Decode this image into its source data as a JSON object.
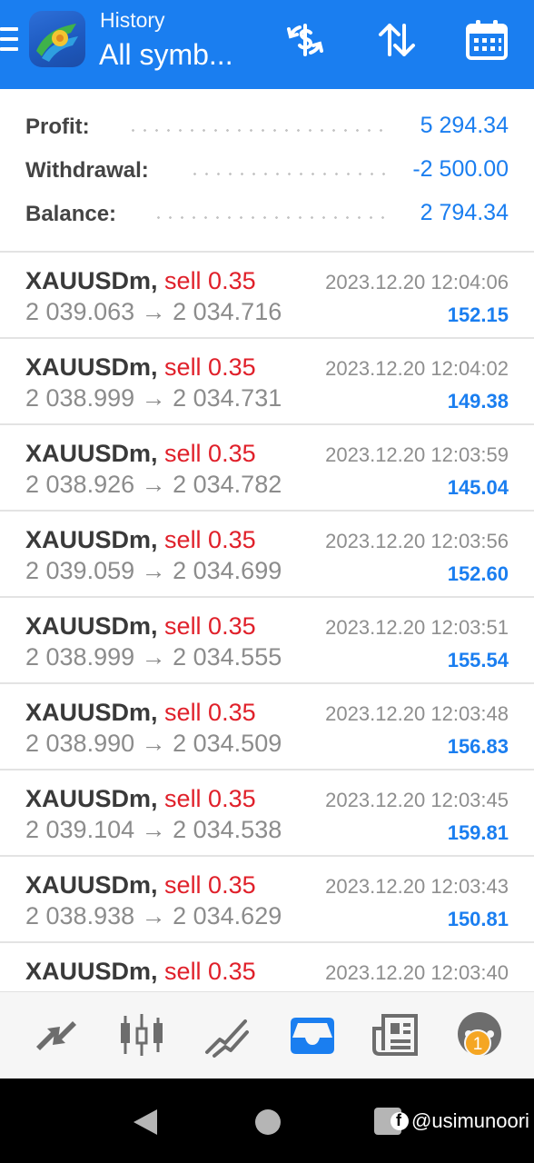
{
  "header": {
    "subtitle": "History",
    "title": "All symb...",
    "buttons": [
      "currency-exchange-icon",
      "sort-icon",
      "calendar-icon"
    ]
  },
  "summary": {
    "profit_label": "Profit:",
    "profit_value": "5 294.34",
    "withdrawal_label": "Withdrawal:",
    "withdrawal_value": "-2 500.00",
    "balance_label": "Balance:",
    "balance_value": "2 794.34"
  },
  "trades": [
    {
      "symbol": "XAUUSDm,",
      "side": "sell 0.35",
      "prices": "2 039.063 → 2 034.716",
      "time": "2023.12.20 12:04:06",
      "profit": "152.15"
    },
    {
      "symbol": "XAUUSDm,",
      "side": "sell 0.35",
      "prices": "2 038.999 → 2 034.731",
      "time": "2023.12.20 12:04:02",
      "profit": "149.38"
    },
    {
      "symbol": "XAUUSDm,",
      "side": "sell 0.35",
      "prices": "2 038.926 → 2 034.782",
      "time": "2023.12.20 12:03:59",
      "profit": "145.04"
    },
    {
      "symbol": "XAUUSDm,",
      "side": "sell 0.35",
      "prices": "2 039.059 → 2 034.699",
      "time": "2023.12.20 12:03:56",
      "profit": "152.60"
    },
    {
      "symbol": "XAUUSDm,",
      "side": "sell 0.35",
      "prices": "2 038.999 → 2 034.555",
      "time": "2023.12.20 12:03:51",
      "profit": "155.54"
    },
    {
      "symbol": "XAUUSDm,",
      "side": "sell 0.35",
      "prices": "2 038.990 → 2 034.509",
      "time": "2023.12.20 12:03:48",
      "profit": "156.83"
    },
    {
      "symbol": "XAUUSDm,",
      "side": "sell 0.35",
      "prices": "2 039.104 → 2 034.538",
      "time": "2023.12.20 12:03:45",
      "profit": "159.81"
    },
    {
      "symbol": "XAUUSDm,",
      "side": "sell 0.35",
      "prices": "2 038.938 → 2 034.629",
      "time": "2023.12.20 12:03:43",
      "profit": "150.81"
    },
    {
      "symbol": "XAUUSDm,",
      "side": "sell 0.35",
      "time": "2023.12.20 12:03:40"
    }
  ],
  "bottom_nav": {
    "items": [
      "trade-arrows-icon",
      "candlestick-chart-icon",
      "trend-lines-icon",
      "history-inbox-icon",
      "news-icon",
      "chat-icon"
    ],
    "active": "history-inbox-icon",
    "chat_badge": "1"
  },
  "system_bar": {
    "watermark": "@usimunoori"
  },
  "colors": {
    "accent": "#1a7ef0",
    "sell": "#e0202a",
    "badge": "#f5a623"
  }
}
